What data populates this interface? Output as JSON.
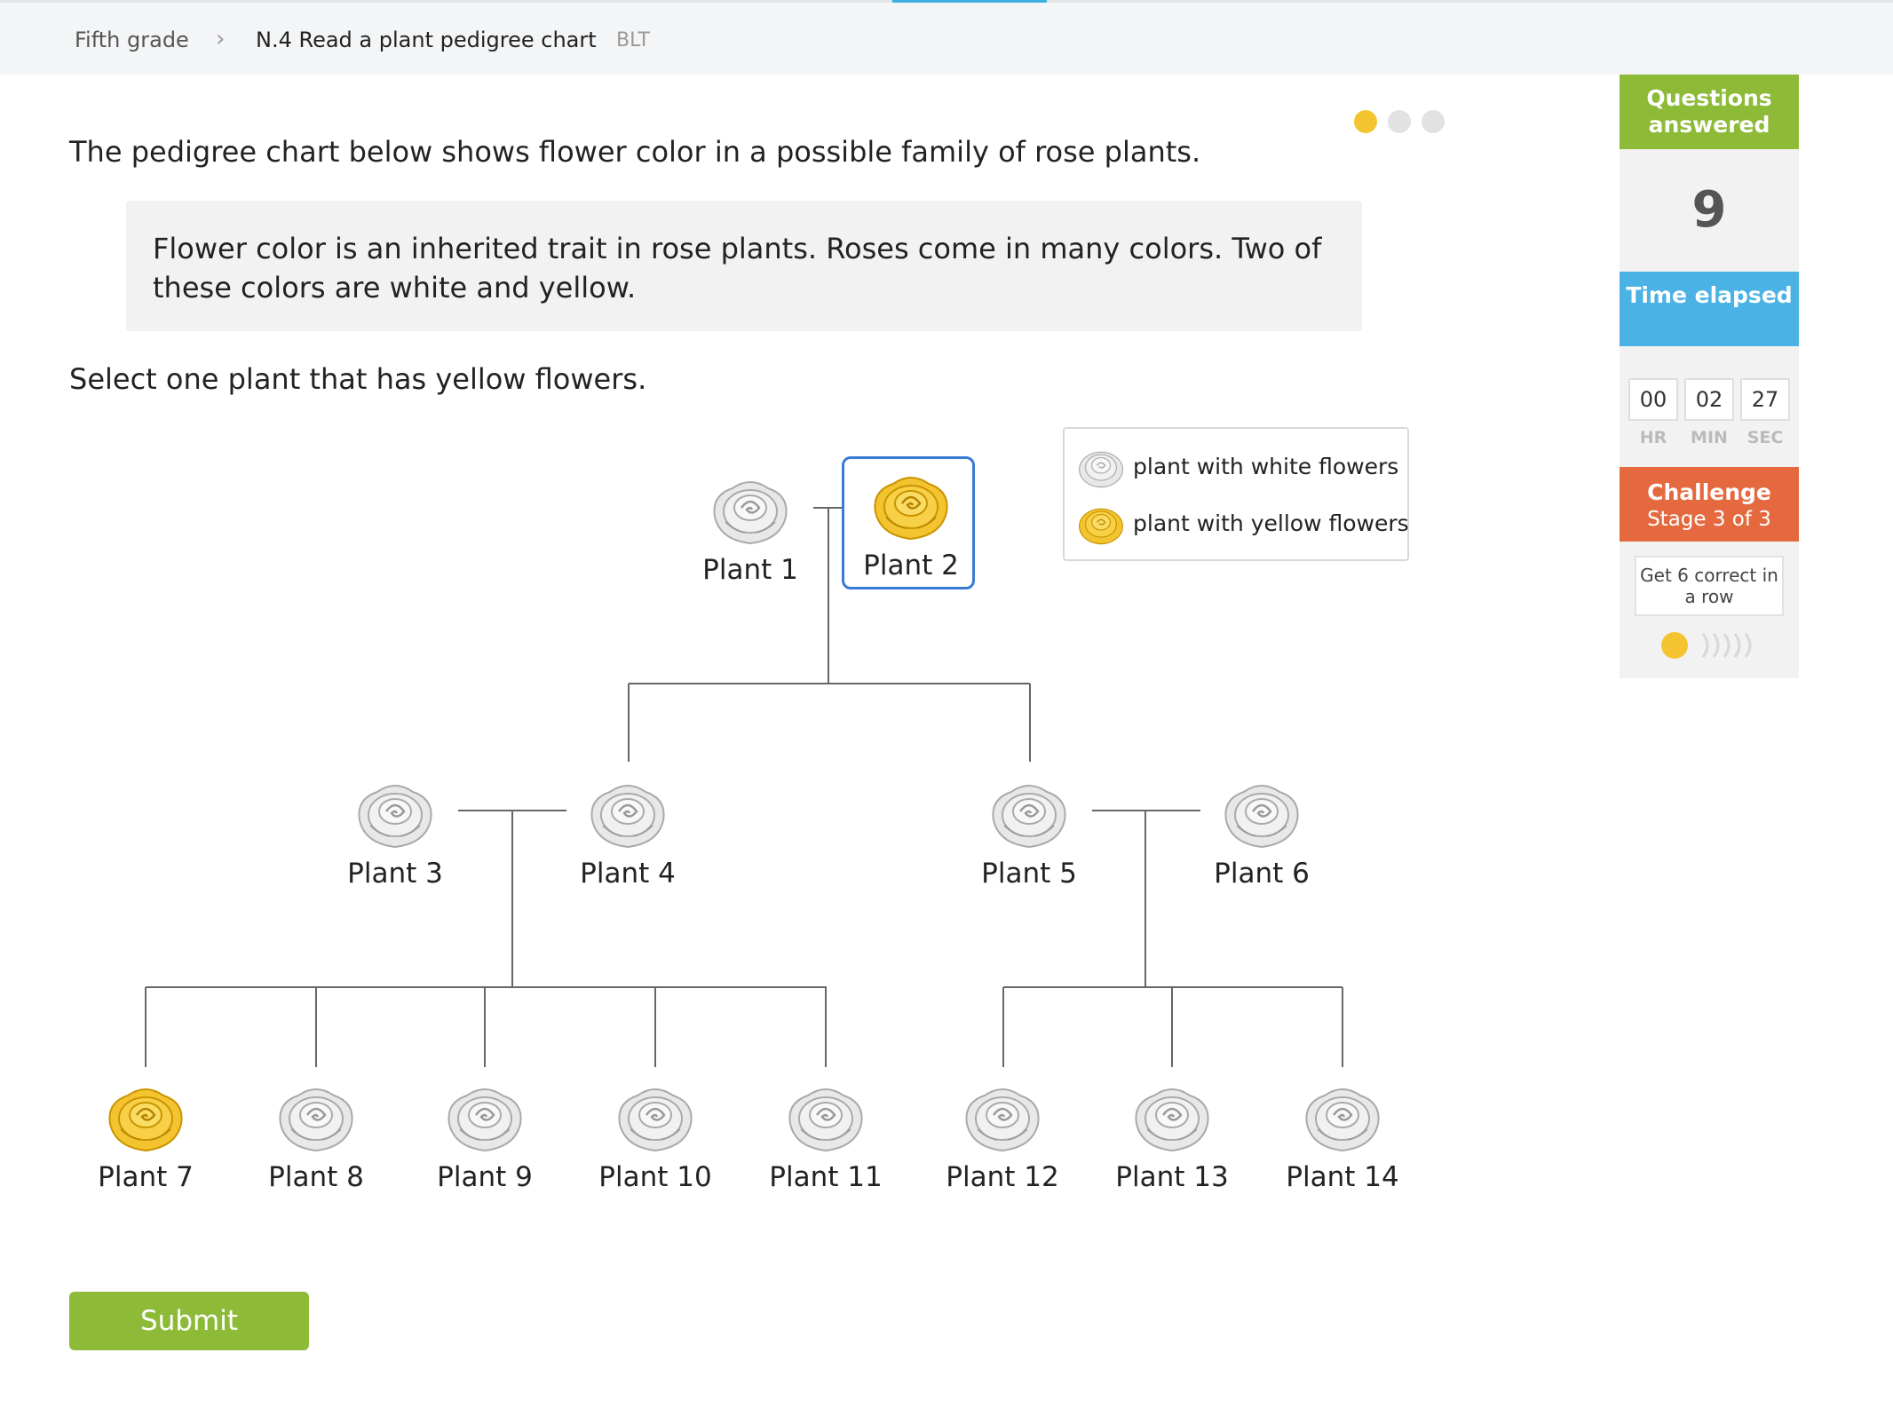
{
  "breadcrumb": {
    "grade": "Fifth grade",
    "separator": "›",
    "skill": "N.4 Read a plant pedigree chart",
    "code": "BLT"
  },
  "question": {
    "intro": "The pedigree chart below shows flower color in a possible family of rose plants.",
    "info": "Flower color is an inherited trait in rose plants. Roses come in many colors. Two of these colors are white and yellow.",
    "prompt": "Select one plant that has yellow flowers."
  },
  "legend": {
    "white_label": "plant with white flowers",
    "yellow_label": "plant with yellow flowers"
  },
  "plants": [
    {
      "label": "Plant 1",
      "color": "white"
    },
    {
      "label": "Plant 2",
      "color": "yellow",
      "selected": true
    },
    {
      "label": "Plant 3",
      "color": "white"
    },
    {
      "label": "Plant 4",
      "color": "white"
    },
    {
      "label": "Plant 5",
      "color": "white"
    },
    {
      "label": "Plant 6",
      "color": "white"
    },
    {
      "label": "Plant 7",
      "color": "yellow"
    },
    {
      "label": "Plant 8",
      "color": "white"
    },
    {
      "label": "Plant 9",
      "color": "white"
    },
    {
      "label": "Plant 10",
      "color": "white"
    },
    {
      "label": "Plant 11",
      "color": "white"
    },
    {
      "label": "Plant 12",
      "color": "white"
    },
    {
      "label": "Plant 13",
      "color": "white"
    },
    {
      "label": "Plant 14",
      "color": "white"
    }
  ],
  "submit_label": "Submit",
  "sidebar": {
    "questions_answered_label": "Questions answered",
    "questions_answered": "9",
    "time_elapsed_label": "Time elapsed",
    "time": {
      "hr": "00",
      "min": "02",
      "sec": "27"
    },
    "units": {
      "hr": "HR",
      "min": "MIN",
      "sec": "SEC"
    },
    "challenge_label": "Challenge",
    "challenge_stage": "Stage 3 of 3",
    "goal": "Get 6 correct in a row",
    "streak": 1,
    "streak_total": 6
  },
  "question_progress": {
    "current": 1,
    "total": 3
  },
  "colors": {
    "green": "#8dba37",
    "blue": "#4bb2e5",
    "orange": "#e4693f",
    "yellow_flower": "#f4c430",
    "white_flower": "#e8e8e8",
    "selected_border": "#3a7bd5"
  }
}
